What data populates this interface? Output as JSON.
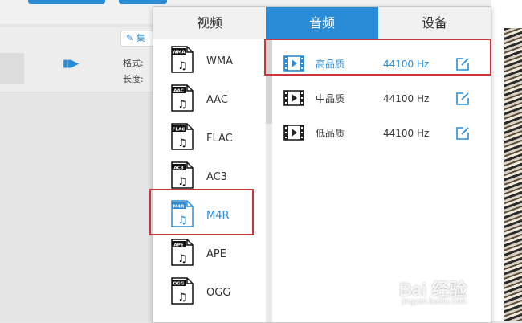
{
  "tabs": [
    {
      "label": "视频",
      "active": false
    },
    {
      "label": "音频",
      "active": true
    },
    {
      "label": "设备",
      "active": false
    }
  ],
  "formats": [
    {
      "icon_text": "WMA",
      "label": "WMA",
      "selected": false
    },
    {
      "icon_text": "AAC",
      "label": "AAC",
      "selected": false
    },
    {
      "icon_text": "FLAC",
      "label": "FLAC",
      "selected": false
    },
    {
      "icon_text": "AC3",
      "label": "AC3",
      "selected": false
    },
    {
      "icon_text": "M4R",
      "label": "M4R",
      "selected": true
    },
    {
      "icon_text": "APE",
      "label": "APE",
      "selected": false
    },
    {
      "icon_text": "OGG",
      "label": "OGG",
      "selected": false
    }
  ],
  "qualities": [
    {
      "name": "高品质",
      "rate": "44100 Hz",
      "selected": true
    },
    {
      "name": "中品质",
      "rate": "44100 Hz",
      "selected": false
    },
    {
      "name": "低品质",
      "rate": "44100 Hz",
      "selected": false
    }
  ],
  "background": {
    "edit_label": "集",
    "format_label": "格式:",
    "length_label": "长度:"
  },
  "watermark": {
    "text": "Bai 经验",
    "url": "jingyan.baidu.com"
  },
  "colors": {
    "accent": "#2a8cd6",
    "highlight": "#c8373b"
  }
}
